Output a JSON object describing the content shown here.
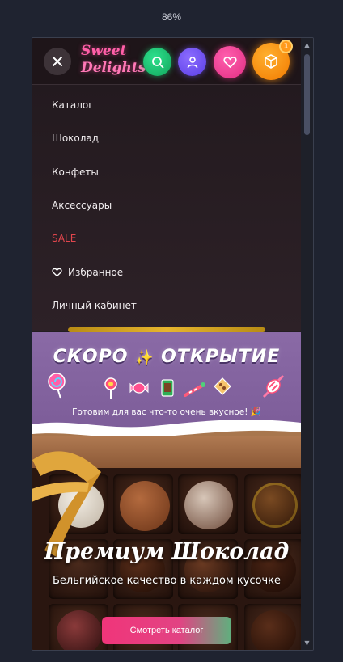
{
  "browser": {
    "zoom": "86%"
  },
  "header": {
    "logo_line1": "Sweet",
    "logo_line2": "Delights",
    "cart_count": "1",
    "icons": [
      "close-icon",
      "search-icon",
      "user-icon",
      "heart-icon",
      "cube-icon"
    ],
    "colors": {
      "search": "#1ec874",
      "account": "#7456f4",
      "favorites": "#f23d92",
      "cart": "#f79412"
    }
  },
  "menu": {
    "items": [
      {
        "label": "Каталог"
      },
      {
        "label": "Шоколад"
      },
      {
        "label": "Конфеты"
      },
      {
        "label": "Аксессуары"
      },
      {
        "label": "SALE"
      },
      {
        "label": "Избранное"
      },
      {
        "label": "Личный кабинет"
      }
    ],
    "sale_color": "#e2464d"
  },
  "coming_soon": {
    "title_part1": "СКОРО",
    "title_part2": "ОТКРЫТИЕ",
    "subtitle": "Готовим для вас что-то очень вкусное!"
  },
  "hero": {
    "title": "Премиум Шоколад",
    "subtitle": "Бельгийское качество в каждом кусочке",
    "cta_label": "Смотреть каталог"
  }
}
